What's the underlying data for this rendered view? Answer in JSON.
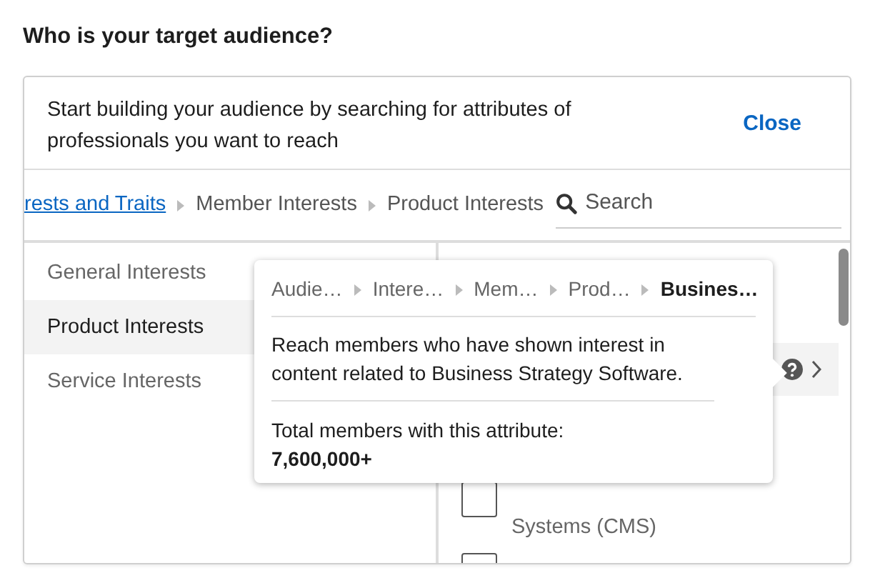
{
  "heading": "Who is your target audience?",
  "intro": {
    "text": "Start building your audience by searching for attributes of professionals you want to reach",
    "close": "Close"
  },
  "breadcrumb": [
    {
      "label": "rests and Traits",
      "kind": "link"
    },
    {
      "label": "Member Interests",
      "kind": "plain"
    },
    {
      "label": "Product Interests",
      "kind": "plain"
    }
  ],
  "search": {
    "placeholder": "Search"
  },
  "categories": [
    {
      "label": "General Interests",
      "selected": false
    },
    {
      "label": "Product Interests",
      "selected": true
    },
    {
      "label": "Service Interests",
      "selected": false
    }
  ],
  "options": [
    {
      "kind": "hovered"
    },
    {
      "kind": "checkbox",
      "label": "Systems (CMS)",
      "checked": false
    },
    {
      "kind": "checkbox",
      "checked": false
    }
  ],
  "tooltip": {
    "path": [
      "Audie…",
      "Intere…",
      "Mem…",
      "Prod…",
      "Busines…"
    ],
    "description": "Reach members who have shown interest in content related to Business Strategy Software.",
    "total_label": "Total members with this attribute:",
    "total": "7,600,000+"
  }
}
